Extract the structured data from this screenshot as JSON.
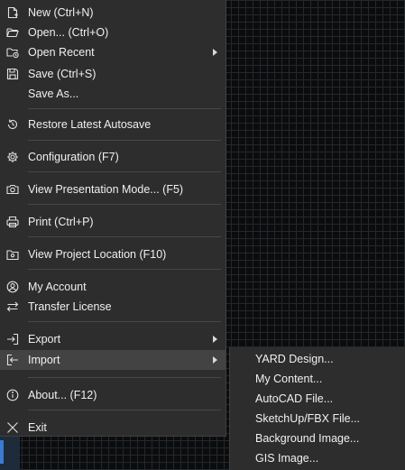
{
  "menu": {
    "new": "New (Ctrl+N)",
    "open": "Open... (Ctrl+O)",
    "open_recent": "Open Recent",
    "save": "Save (Ctrl+S)",
    "save_as": "Save As...",
    "restore_autosave": "Restore Latest Autosave",
    "configuration": "Configuration (F7)",
    "presentation_mode": "View Presentation Mode... (F5)",
    "print": "Print (Ctrl+P)",
    "project_location": "View Project Location (F10)",
    "my_account": "My Account",
    "transfer_license": "Transfer License",
    "export": "Export",
    "import": "Import",
    "about": "About... (F12)",
    "exit": "Exit"
  },
  "import_submenu": {
    "items": [
      "YARD Design...",
      "My Content...",
      "AutoCAD File...",
      "SketchUp/FBX File...",
      "Background Image...",
      "GIS Image..."
    ]
  },
  "icons": {
    "new": "new-file-icon",
    "open": "folder-open-icon",
    "open_recent": "folder-recent-icon",
    "save": "floppy-disk-icon",
    "restore": "restore-icon",
    "configuration": "gear-icon",
    "presentation": "camera-icon",
    "print": "printer-icon",
    "project_location": "folder-location-icon",
    "account": "user-circle-icon",
    "transfer": "transfer-arrows-icon",
    "export": "export-icon",
    "import": "import-icon",
    "about": "info-icon",
    "exit": "close-icon"
  },
  "colors": {
    "menu_bg": "#2d2d2d",
    "active_bg": "#434343",
    "text": "#f0f0f0",
    "accent": "#3a7bd5"
  }
}
